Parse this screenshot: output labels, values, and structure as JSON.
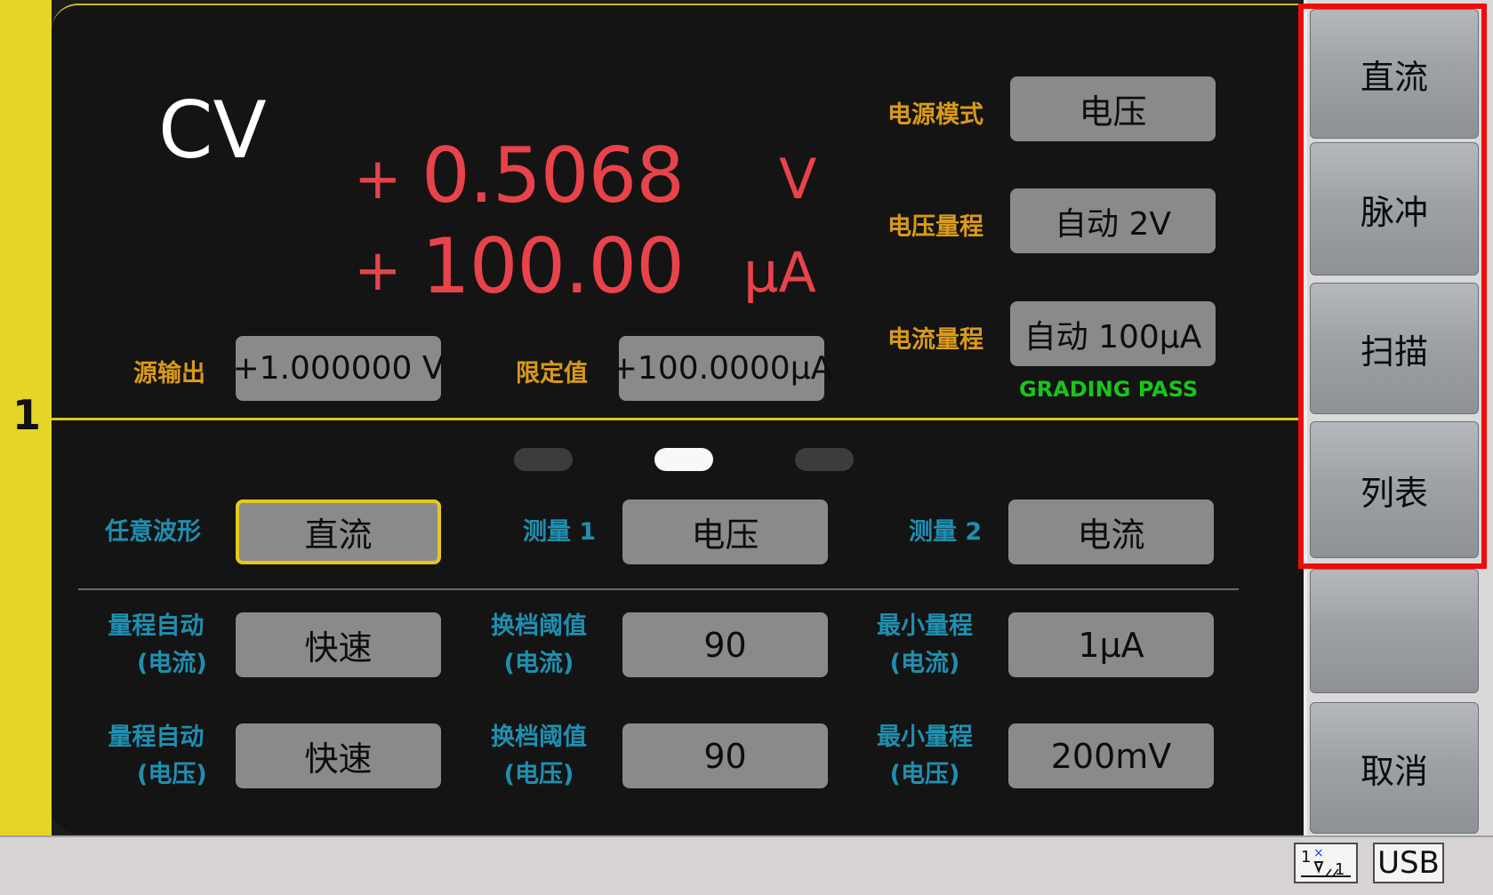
{
  "channel": {
    "number": "1"
  },
  "display": {
    "mode": "CV",
    "voltage": {
      "sign": "+",
      "value": "0.5068",
      "unit": "V"
    },
    "current": {
      "sign": "+",
      "value": "100.00",
      "unit": "µA"
    }
  },
  "source": {
    "output_label": "源输出",
    "output_value": "+1.000000 V",
    "limit_label": "限定值",
    "limit_value": "+100.0000µA"
  },
  "settings": {
    "power_mode_label": "电源模式",
    "power_mode_value": "电压",
    "voltage_range_label": "电压量程",
    "voltage_range_value": "自动 2V",
    "current_range_label": "电流量程",
    "current_range_value": "自动 100µA",
    "grading": "GRADING PASS"
  },
  "page_indicator": {
    "total": 3,
    "active": 1
  },
  "row1": {
    "waveform_label": "任意波形",
    "waveform_value": "直流",
    "meas1_label": "测量 1",
    "meas1_value": "电压",
    "meas2_label": "测量 2",
    "meas2_value": "电流"
  },
  "row2": {
    "auto_label_line1": "量程自动",
    "auto_label_line2": "(电流)",
    "auto_value": "快速",
    "thresh_label_line1": "换档阈值",
    "thresh_label_line2": "(电流)",
    "thresh_value": "90",
    "min_label_line1": "最小量程",
    "min_label_line2": "(电流)",
    "min_value": "1µA"
  },
  "row3": {
    "auto_label_line1": "量程自动",
    "auto_label_line2": "(电压)",
    "auto_value": "快速",
    "thresh_label_line1": "换档阈值",
    "thresh_label_line2": "(电压)",
    "thresh_value": "90",
    "min_label_line1": "最小量程",
    "min_label_line2": "(电压)",
    "min_value": "200mV"
  },
  "softkeys": [
    "直流",
    "脉冲",
    "扫描",
    "列表",
    "",
    "取消"
  ],
  "status": {
    "usb": "USB",
    "trigger_icon": "trigger-icon"
  },
  "colors": {
    "accent_yellow": "#e4d526",
    "reading_red": "#e8434a",
    "label_orange": "#d99a1a",
    "label_blue": "#1f8fb0",
    "pass_green": "#19c51b",
    "highlight_red": "#ee0b0b"
  }
}
